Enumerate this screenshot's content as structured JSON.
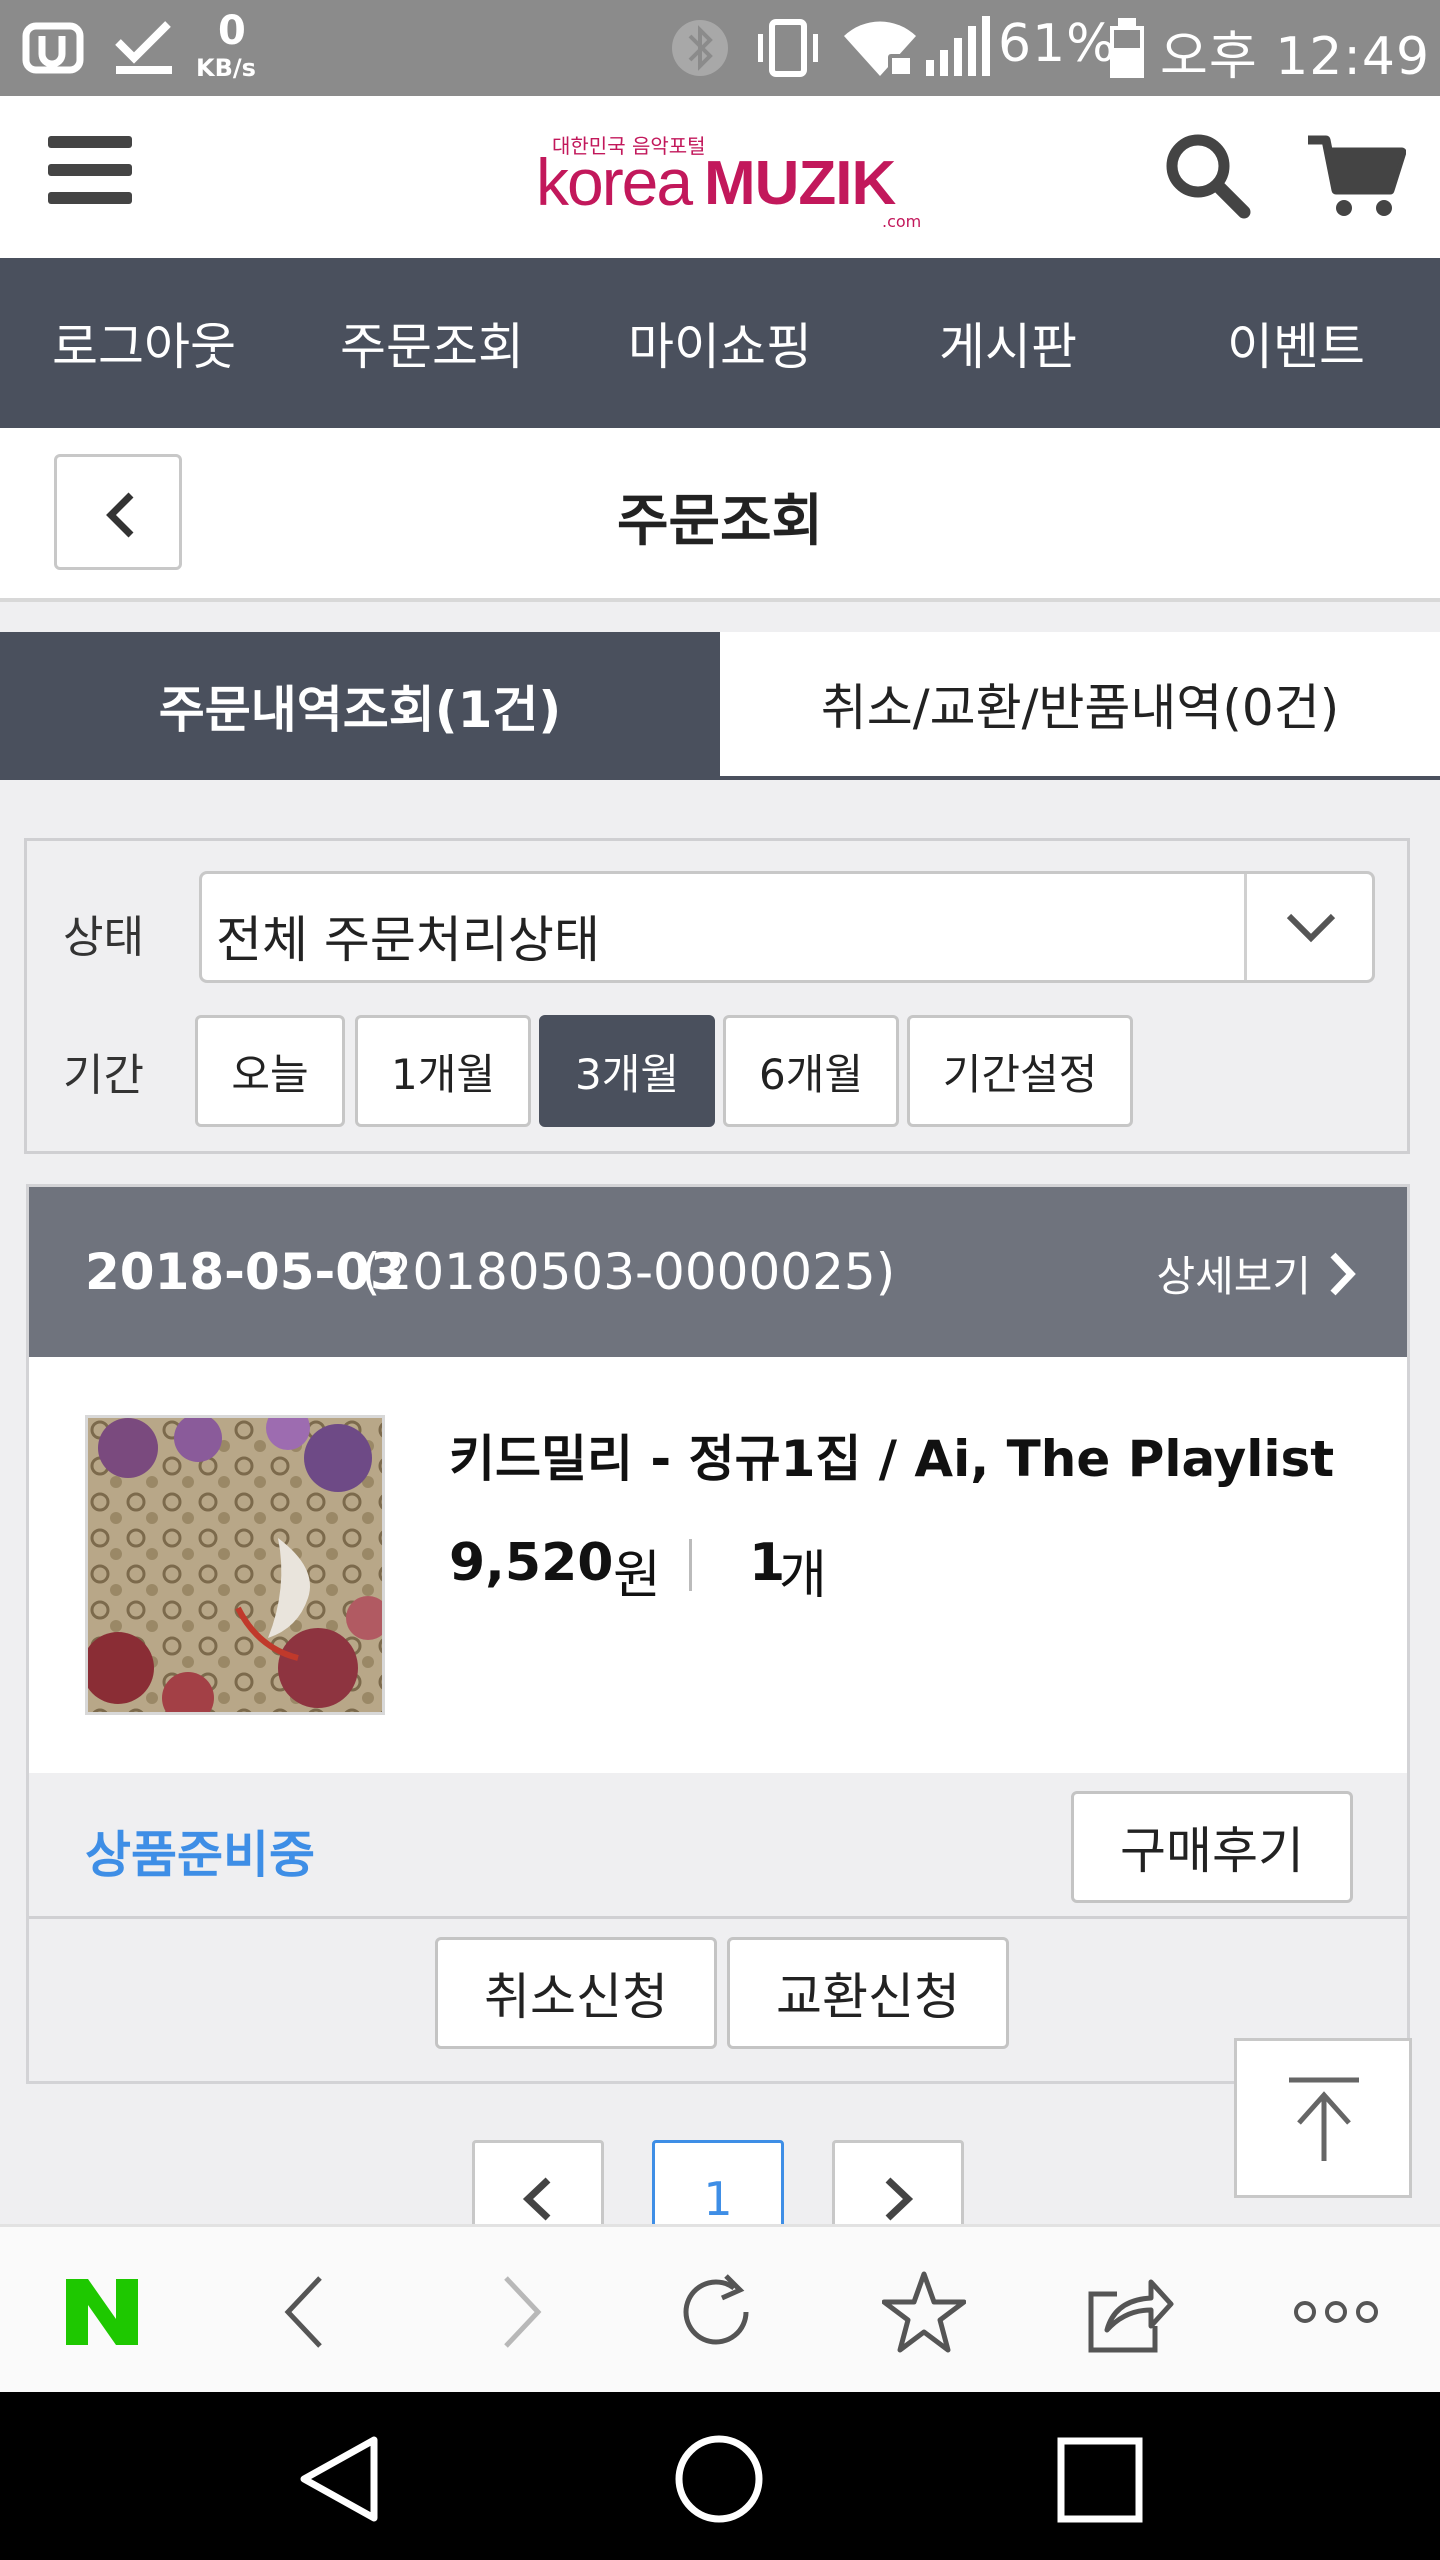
{
  "status_bar": {
    "speed_value": "0",
    "speed_unit": "KB/s",
    "battery": "61%",
    "time": "오후 12:49"
  },
  "header": {
    "logo_tagline": "대한민국 음악포털",
    "logo_korea": "korea",
    "logo_muzik": "MUZIK",
    "logo_com": ".com"
  },
  "nav": {
    "items": [
      {
        "label": "로그아웃"
      },
      {
        "label": "주문조회"
      },
      {
        "label": "마이쇼핑"
      },
      {
        "label": "게시판"
      },
      {
        "label": "이벤트"
      }
    ]
  },
  "page": {
    "title": "주문조회"
  },
  "tabs": [
    {
      "label": "주문내역조회(1건)",
      "active": true
    },
    {
      "label": "취소/교환/반품내역(0건)",
      "active": false
    }
  ],
  "filter": {
    "status_label": "상태",
    "status_value": "전체 주문처리상태",
    "period_label": "기간",
    "periods": [
      {
        "label": "오늘"
      },
      {
        "label": "1개월"
      },
      {
        "label": "3개월"
      },
      {
        "label": "6개월"
      },
      {
        "label": "기간설정"
      }
    ],
    "active_period": "3개월"
  },
  "order": {
    "date": "2018-05-03",
    "order_number": "(20180503-0000025)",
    "detail_label": "상세보기",
    "product_name": "키드밀리 - 정규1집 / Ai, The Playlist",
    "price": "9,520",
    "price_unit": "원",
    "quantity": "1",
    "quantity_unit": "개",
    "status": "상품준비중",
    "review_label": "구매후기",
    "cancel_label": "취소신청",
    "exchange_label": "교환신청"
  },
  "pagination": {
    "current": "1"
  },
  "colors": {
    "nav_bg": "#4a505d",
    "order_head_bg": "#6f737d",
    "status_blue": "#3e8ee6",
    "brand_pink": "#c2185b",
    "naver_green": "#1ec800"
  },
  "icons": {
    "browser_toolbar": [
      "naver-icon",
      "back-icon",
      "forward-icon",
      "refresh-icon",
      "star-icon",
      "share-icon",
      "more-icon"
    ],
    "system_nav": [
      "back-triangle-icon",
      "home-circle-icon",
      "recents-square-icon"
    ]
  }
}
